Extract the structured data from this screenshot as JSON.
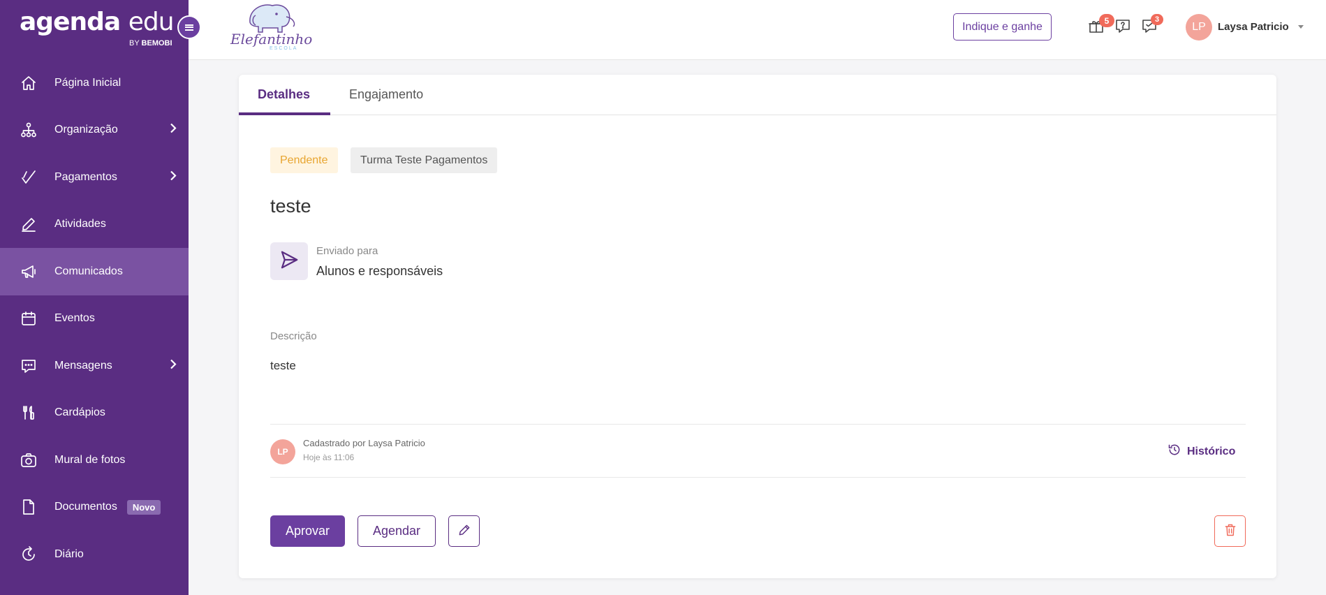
{
  "brand": {
    "name_bold": "agenda",
    "name_light": "edu",
    "by_label": "BY",
    "by_company": "BEMOBI"
  },
  "school": {
    "name": "Elefantinho",
    "subtitle": "ESCOLA"
  },
  "sidebar": {
    "items": [
      {
        "label": "Página Inicial",
        "icon": "home-icon"
      },
      {
        "label": "Organização",
        "icon": "org-chart-icon",
        "has_submenu": true
      },
      {
        "label": "Pagamentos",
        "icon": "check-icon",
        "has_submenu": true
      },
      {
        "label": "Atividades",
        "icon": "pencil-icon"
      },
      {
        "label": "Comunicados",
        "icon": "megaphone-icon",
        "active": true
      },
      {
        "label": "Eventos",
        "icon": "calendar-icon"
      },
      {
        "label": "Mensagens",
        "icon": "chat-icon",
        "has_submenu": true
      },
      {
        "label": "Cardápios",
        "icon": "utensils-icon"
      },
      {
        "label": "Mural de fotos",
        "icon": "camera-icon"
      },
      {
        "label": "Documentos",
        "icon": "document-icon",
        "badge": "Novo"
      },
      {
        "label": "Diário",
        "icon": "refresh-clock-icon"
      }
    ]
  },
  "header": {
    "referral_button": "Indique e ganhe",
    "gift_badge": "5",
    "messages_badge": "3",
    "user_initials": "LP",
    "user_name": "Laysa Patricio"
  },
  "tabs": [
    {
      "label": "Detalhes",
      "active": true
    },
    {
      "label": "Engajamento",
      "active": false
    }
  ],
  "detail": {
    "status_tag": "Pendente",
    "class_tag": "Turma Teste Pagamentos",
    "title": "teste",
    "sent_to_label": "Enviado para",
    "sent_to_value": "Alunos e responsáveis",
    "description_label": "Descrição",
    "description_value": "teste",
    "creator_initials": "LP",
    "created_by": "Cadastrado por Laysa Patricio",
    "created_at": "Hoje às 11:06",
    "history_label": "Histórico"
  },
  "actions": {
    "approve": "Aprovar",
    "schedule": "Agendar"
  },
  "colors": {
    "primary": "#5a2d82",
    "danger": "#f06a5a",
    "pending": "#e8a530",
    "avatar": "#f3a49a"
  }
}
